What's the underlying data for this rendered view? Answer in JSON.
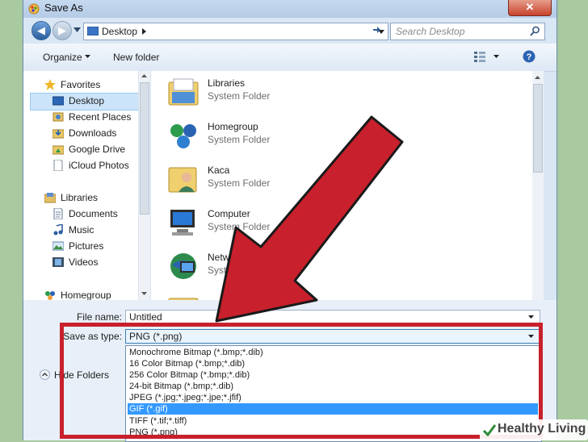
{
  "window": {
    "title": "Save As",
    "close_glyph": "✕"
  },
  "navigation": {
    "back_glyph": "◀",
    "forward_glyph": "▶",
    "breadcrumb": "Desktop",
    "search_placeholder": "Search Desktop"
  },
  "toolbar": {
    "organize_label": "Organize",
    "new_folder_label": "New folder"
  },
  "sidebar": {
    "favorites_label": "Favorites",
    "favorites": [
      "Desktop",
      "Recent Places",
      "Downloads",
      "Google Drive",
      "iCloud Photos"
    ],
    "libraries_label": "Libraries",
    "libraries": [
      "Documents",
      "Music",
      "Pictures",
      "Videos"
    ],
    "homegroup_label": "Homegroup"
  },
  "content": {
    "items": [
      {
        "name": "Libraries",
        "type": "System Folder"
      },
      {
        "name": "Homegroup",
        "type": "System Folder"
      },
      {
        "name": "Kaca",
        "type": "System Folder"
      },
      {
        "name": "Computer",
        "type": "System Folder"
      },
      {
        "name": "Network",
        "type": "System Folder"
      }
    ]
  },
  "form": {
    "file_name_label": "File name:",
    "file_name_value": "Untitled",
    "save_type_label": "Save as type:",
    "save_type_value": "PNG (*.png)",
    "hide_folders_label": "Hide Folders",
    "type_options": [
      "Monochrome Bitmap (*.bmp;*.dib)",
      "16 Color Bitmap (*.bmp;*.dib)",
      "256 Color Bitmap (*.bmp;*.dib)",
      "24-bit Bitmap (*.bmp;*.dib)",
      "JPEG (*.jpg;*.jpeg;*.jpe;*.jfif)",
      "GIF (*.gif)",
      "TIFF (*.tif;*.tiff)",
      "PNG (*.png)"
    ],
    "selected_option_index": 5
  },
  "watermark": {
    "text": "Healthy Living"
  },
  "colors": {
    "annotation_red": "#c8202c",
    "selection_blue": "#3399ff",
    "window_frame": "#d9e6f3"
  }
}
